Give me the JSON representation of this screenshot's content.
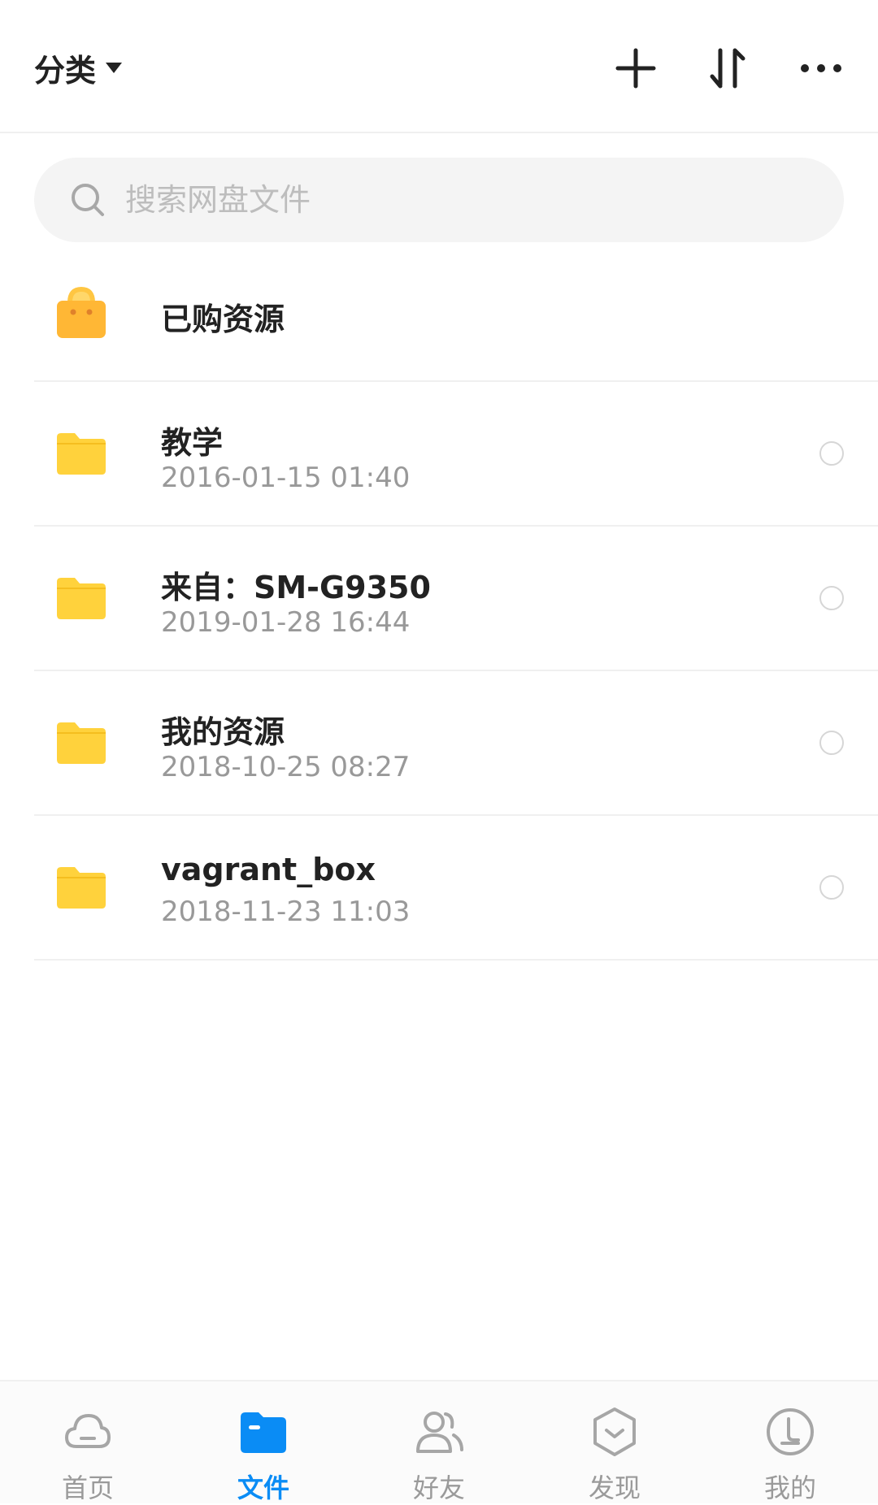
{
  "header": {
    "category_label": "分类",
    "icons": [
      "add-icon",
      "sort-icon",
      "more-icon"
    ]
  },
  "search": {
    "placeholder": "搜索网盘文件"
  },
  "purchased": {
    "label": "已购资源",
    "icon": "shopping-bag-icon"
  },
  "files": [
    {
      "name": "教学",
      "date": "2016-01-15  01:40",
      "icon": "folder-icon"
    },
    {
      "name": "来自：SM-G9350",
      "date": "2019-01-28  16:44",
      "icon": "folder-icon"
    },
    {
      "name": "我的资源",
      "date": "2018-10-25  08:27",
      "icon": "folder-icon"
    },
    {
      "name": "vagrant_box",
      "date": "2018-11-23  11:03",
      "icon": "folder-icon"
    }
  ],
  "tabs": [
    {
      "label": "首页",
      "icon": "cloud-icon",
      "active": false
    },
    {
      "label": "文件",
      "icon": "folder-icon",
      "active": true
    },
    {
      "label": "好友",
      "icon": "friends-icon",
      "active": false
    },
    {
      "label": "发现",
      "icon": "discover-icon",
      "active": false
    },
    {
      "label": "我的",
      "icon": "profile-icon",
      "active": false
    }
  ],
  "colors": {
    "accent": "#0a8cf5",
    "folder": "#ffd23c",
    "bag": "#ffb735",
    "text": "#222222",
    "muted": "#999999"
  }
}
